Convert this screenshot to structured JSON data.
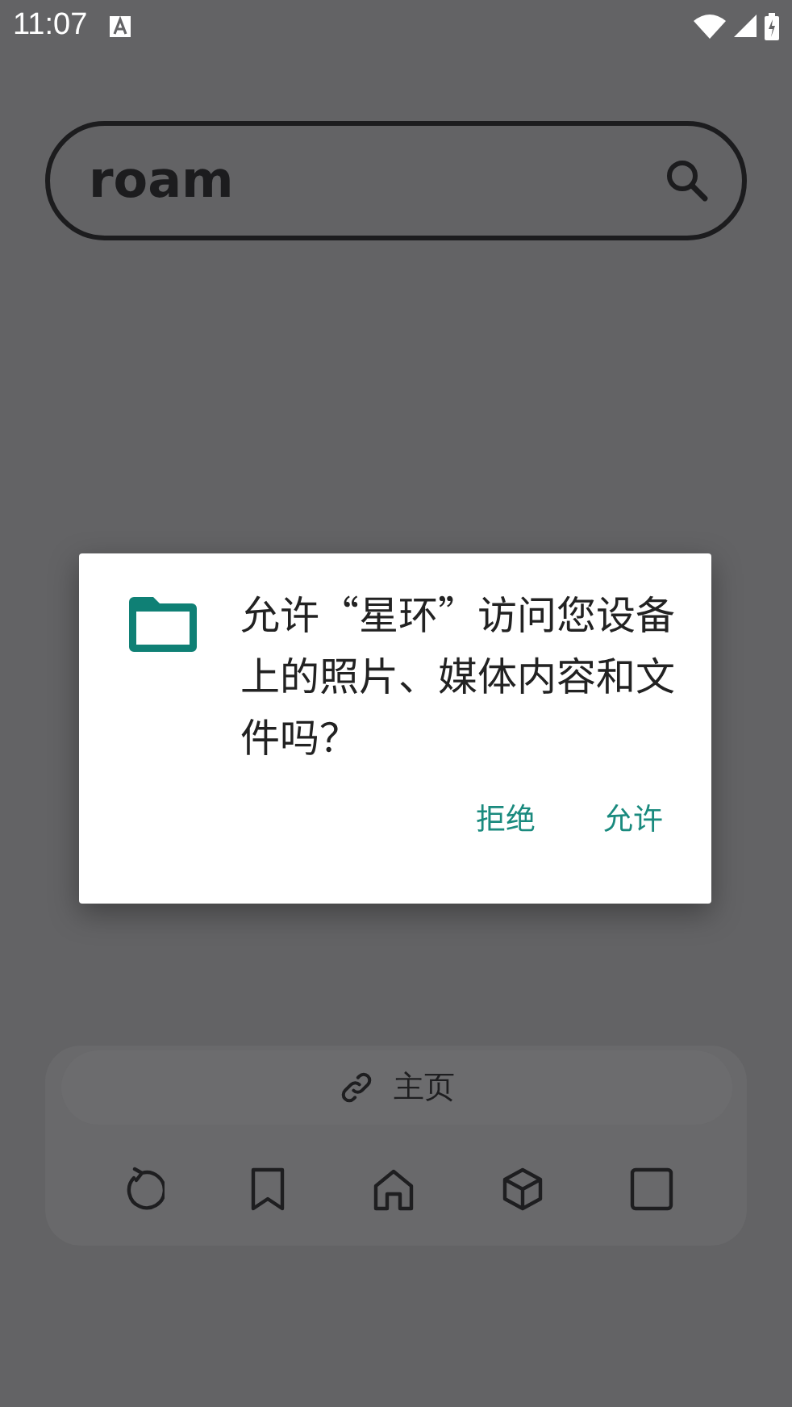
{
  "status_bar": {
    "time": "11:07"
  },
  "search": {
    "value": "roam"
  },
  "dialog": {
    "message": "允许“星环”访问您设备上的照片、媒体内容和文件吗？",
    "buttons": [
      {
        "label": "拒绝"
      },
      {
        "label": "允许"
      }
    ]
  },
  "bottom_bar": {
    "address": "主页"
  }
}
